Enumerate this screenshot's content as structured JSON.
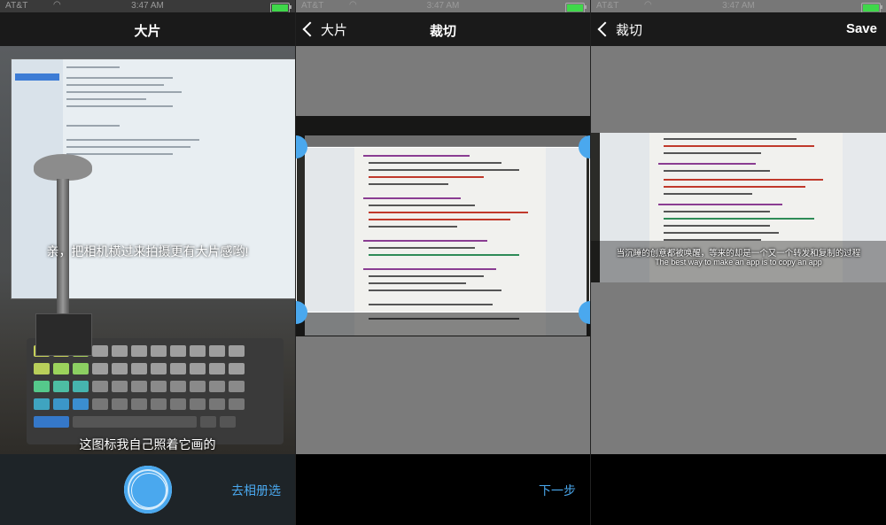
{
  "status_bar": {
    "carrier": "AT&T",
    "wifi_icon": "wifi-icon",
    "time": "3:47 AM",
    "battery_color": "#3fd84a"
  },
  "screen1": {
    "nav_title": "大片",
    "prompt_text": "亲，把相机横过来拍摄更有大片感哟!",
    "caption_text": "这图标我自己照着它画的",
    "shutter_icon": "camera-shutter-icon",
    "album_link": "去相册选"
  },
  "screen2": {
    "back_label": "大片",
    "nav_title": "裁切",
    "next_label": "下一步"
  },
  "screen3": {
    "back_label": "裁切",
    "save_label": "Save",
    "subtitle_cn": "当沉睡的创意都被唤醒，等来的却是一个又一个转发和复制的过程",
    "subtitle_en": "The best way to make an app is to copy an app"
  },
  "colors": {
    "accent": "#4aa8ee",
    "navbar": "#1a1a1a",
    "shutter_bar": "#1e2428"
  }
}
